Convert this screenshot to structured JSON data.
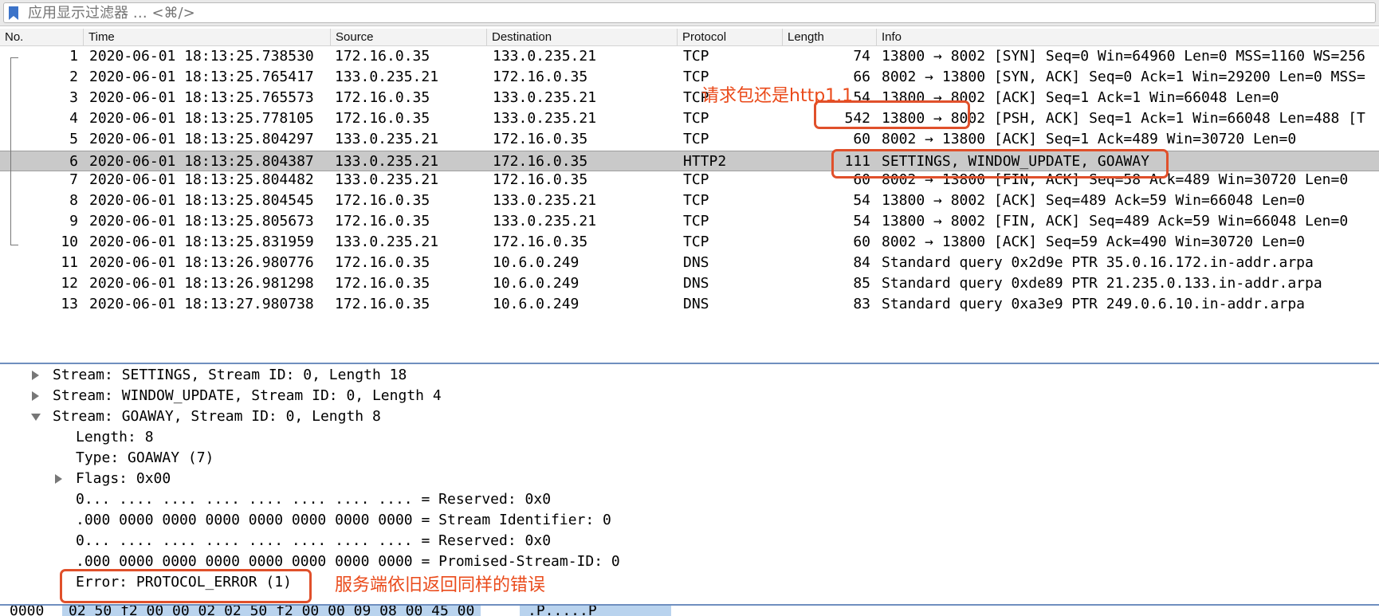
{
  "filter": {
    "placeholder": "应用显示过滤器 … <⌘/>"
  },
  "columns": [
    "No.",
    "Time",
    "Source",
    "Destination",
    "Protocol",
    "Length",
    "Info"
  ],
  "packets": [
    {
      "no": "1",
      "time": "2020-06-01 18:13:25.738530",
      "src": "172.16.0.35",
      "dst": "133.0.235.21",
      "proto": "TCP",
      "len": "74",
      "info": "13800 → 8002 [SYN] Seq=0 Win=64960 Len=0 MSS=1160 WS=256"
    },
    {
      "no": "2",
      "time": "2020-06-01 18:13:25.765417",
      "src": "133.0.235.21",
      "dst": "172.16.0.35",
      "proto": "TCP",
      "len": "66",
      "info": "8002 → 13800 [SYN, ACK] Seq=0 Ack=1 Win=29200 Len=0 MSS="
    },
    {
      "no": "3",
      "time": "2020-06-01 18:13:25.765573",
      "src": "172.16.0.35",
      "dst": "133.0.235.21",
      "proto": "TCP",
      "len": "54",
      "info": "13800 → 8002 [ACK] Seq=1 Ack=1 Win=66048 Len=0"
    },
    {
      "no": "4",
      "time": "2020-06-01 18:13:25.778105",
      "src": "172.16.0.35",
      "dst": "133.0.235.21",
      "proto": "TCP",
      "len": "542",
      "info": "13800 → 8002 [PSH, ACK] Seq=1 Ack=1 Win=66048 Len=488 [T"
    },
    {
      "no": "5",
      "time": "2020-06-01 18:13:25.804297",
      "src": "133.0.235.21",
      "dst": "172.16.0.35",
      "proto": "TCP",
      "len": "60",
      "info": "8002 → 13800 [ACK] Seq=1 Ack=489 Win=30720 Len=0"
    },
    {
      "no": "6",
      "time": "2020-06-01 18:13:25.804387",
      "src": "133.0.235.21",
      "dst": "172.16.0.35",
      "proto": "HTTP2",
      "len": "111",
      "info": "SETTINGS, WINDOW_UPDATE, GOAWAY"
    },
    {
      "no": "7",
      "time": "2020-06-01 18:13:25.804482",
      "src": "133.0.235.21",
      "dst": "172.16.0.35",
      "proto": "TCP",
      "len": "60",
      "info": "8002 → 13800 [FIN, ACK] Seq=58 Ack=489 Win=30720 Len=0"
    },
    {
      "no": "8",
      "time": "2020-06-01 18:13:25.804545",
      "src": "172.16.0.35",
      "dst": "133.0.235.21",
      "proto": "TCP",
      "len": "54",
      "info": "13800 → 8002 [ACK] Seq=489 Ack=59 Win=66048 Len=0"
    },
    {
      "no": "9",
      "time": "2020-06-01 18:13:25.805673",
      "src": "172.16.0.35",
      "dst": "133.0.235.21",
      "proto": "TCP",
      "len": "54",
      "info": "13800 → 8002 [FIN, ACK] Seq=489 Ack=59 Win=66048 Len=0"
    },
    {
      "no": "10",
      "time": "2020-06-01 18:13:25.831959",
      "src": "133.0.235.21",
      "dst": "172.16.0.35",
      "proto": "TCP",
      "len": "60",
      "info": "8002 → 13800 [ACK] Seq=59 Ack=490 Win=30720 Len=0"
    },
    {
      "no": "11",
      "time": "2020-06-01 18:13:26.980776",
      "src": "172.16.0.35",
      "dst": "10.6.0.249",
      "proto": "DNS",
      "len": "84",
      "info": "Standard query 0x2d9e PTR 35.0.16.172.in-addr.arpa"
    },
    {
      "no": "12",
      "time": "2020-06-01 18:13:26.981298",
      "src": "172.16.0.35",
      "dst": "10.6.0.249",
      "proto": "DNS",
      "len": "85",
      "info": "Standard query 0xde89 PTR 21.235.0.133.in-addr.arpa"
    },
    {
      "no": "13",
      "time": "2020-06-01 18:13:27.980738",
      "src": "172.16.0.35",
      "dst": "10.6.0.249",
      "proto": "DNS",
      "len": "83",
      "info": "Standard query 0xa3e9 PTR 249.0.6.10.in-addr.arpa"
    }
  ],
  "selected_packet": "6",
  "details": {
    "stream_settings": "Stream: SETTINGS, Stream ID: 0, Length 18",
    "stream_window_update": "Stream: WINDOW_UPDATE, Stream ID: 0, Length 4",
    "stream_goaway": "Stream: GOAWAY, Stream ID: 0, Length 8",
    "length": "Length: 8",
    "type": "Type: GOAWAY (7)",
    "flags": "Flags: 0x00",
    "reserved1": "0... .... .... .... .... .... .... .... = Reserved: 0x0",
    "stream_identifier": ".000 0000 0000 0000 0000 0000 0000 0000 = Stream Identifier: 0",
    "reserved2": "0... .... .... .... .... .... .... .... = Reserved: 0x0",
    "promised_stream": ".000 0000 0000 0000 0000 0000 0000 0000 = Promised-Stream-ID: 0",
    "error": "Error: PROTOCOL_ERROR (1)"
  },
  "bytes": {
    "offset": "0000",
    "hex": "02 50 f2 00 00 02 02 50  f2 00 00 09 08 00 45 00",
    "ascii": ".P.....P ......E."
  },
  "annotations": {
    "request_note": "请求包还是http1.1",
    "error_note": "服务端依旧返回同样的错误"
  },
  "colors": {
    "annotation": "#e0502b",
    "selected_row": "#c9c9c9",
    "pane_divider": "#6f8fbf"
  }
}
